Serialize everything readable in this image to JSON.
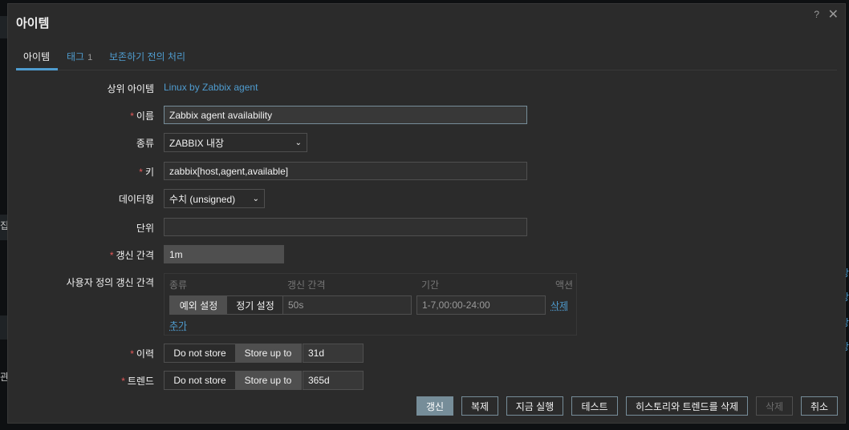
{
  "dialog": {
    "title": "아이템",
    "help": "?",
    "close": "✕"
  },
  "tabs": [
    {
      "label": "아이템",
      "count": ""
    },
    {
      "label": "태그",
      "count": "1"
    },
    {
      "label": "보존하기 전의 처리",
      "count": ""
    }
  ],
  "form": {
    "parent_item": {
      "label": "상위 아이템",
      "value": "Linux by Zabbix agent"
    },
    "name": {
      "label": "이름",
      "value": "Zabbix agent availability"
    },
    "type": {
      "label": "종류",
      "value": "ZABBIX 내장"
    },
    "key": {
      "label": "키",
      "value": "zabbix[host,agent,available]"
    },
    "data_type": {
      "label": "데이터형",
      "value": "수치 (unsigned)"
    },
    "units": {
      "label": "단위",
      "value": ""
    },
    "update_interval": {
      "label": "갱신 간격",
      "value": "1m"
    },
    "custom_intervals": {
      "label": "사용자 정의 갱신 간격",
      "headers": {
        "type": "종류",
        "interval": "갱신 간격",
        "period": "기간",
        "action": "액션"
      },
      "row": {
        "type_flexible": "예외 설정",
        "type_scheduling": "정기 설정",
        "interval_placeholder": "50s",
        "period_placeholder": "1-7,00:00-24:00",
        "remove": "삭제"
      },
      "add": "추가"
    },
    "history": {
      "label": "이력",
      "do_not_store": "Do not store",
      "store_up_to": "Store up to",
      "value": "31d"
    },
    "trends": {
      "label": "트렌드",
      "do_not_store": "Do not store",
      "store_up_to": "Store up to",
      "value": "365d"
    },
    "required_mark": "*"
  },
  "buttons": {
    "update": "갱신",
    "clone": "복제",
    "execute_now": "지금 실행",
    "test": "테스트",
    "clear_history": "히스토리와 트렌드를 삭제",
    "delete": "삭제",
    "cancel": "취소"
  },
  "background": {
    "left_glyph_1": "집",
    "left_glyph_2": "관",
    "right_glyph": "상"
  },
  "colors": {
    "accent": "#4f9ccf",
    "required": "#e45959",
    "primary_button": "#768d99",
    "dialog_bg": "#2b2b2b"
  }
}
